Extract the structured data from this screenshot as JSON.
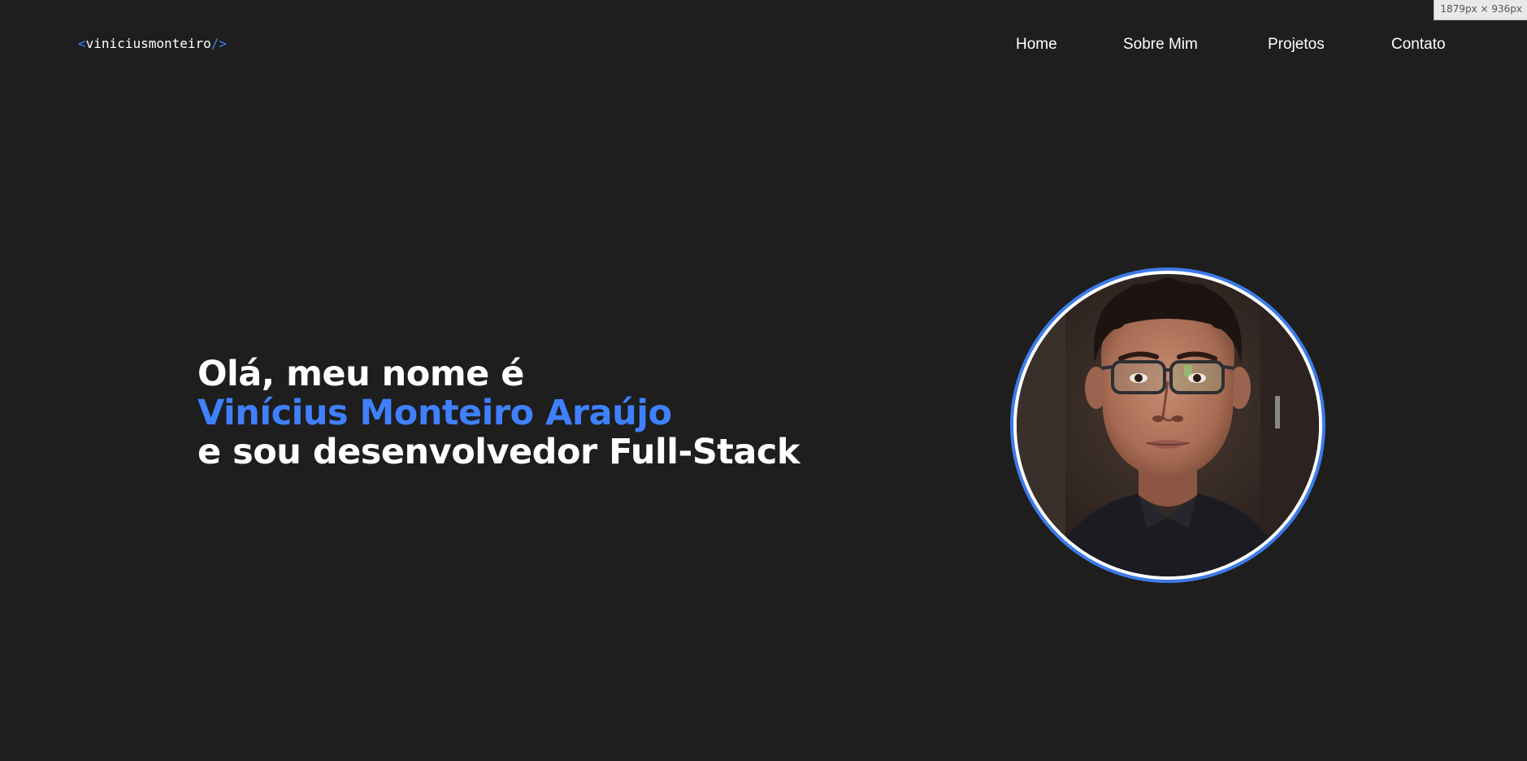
{
  "viewport_badge": "1879px × 936px",
  "logo": {
    "open": "<",
    "name": "viniciusmonteiro",
    "close": "/>"
  },
  "nav": {
    "items": [
      {
        "label": "Home"
      },
      {
        "label": "Sobre Mim"
      },
      {
        "label": "Projetos"
      },
      {
        "label": "Contato"
      }
    ]
  },
  "hero": {
    "greeting": "Olá, meu nome é",
    "name": "Vinícius Monteiro Araújo",
    "role": "e sou desenvolvedor Full-Stack"
  },
  "colors": {
    "background": "#1e1e1e",
    "accent": "#3f80ff",
    "text": "#ffffff",
    "avatar_border": "#3c7bea"
  }
}
